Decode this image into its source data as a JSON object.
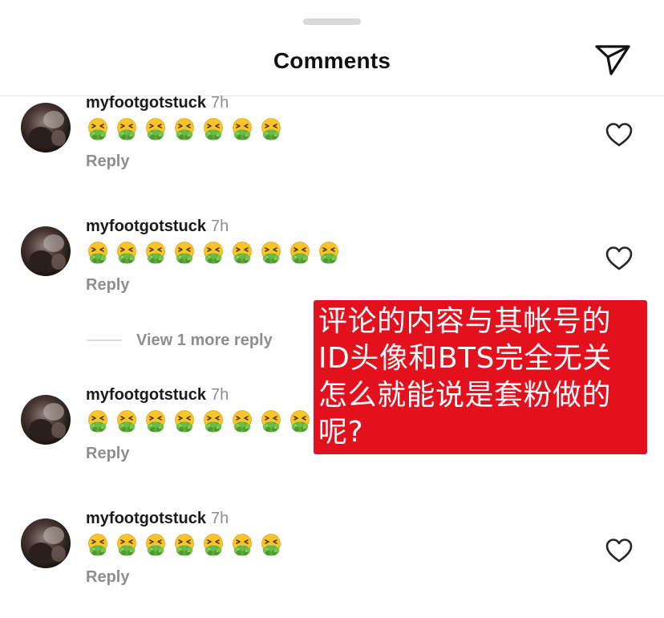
{
  "header": {
    "title": "Comments"
  },
  "comments": [
    {
      "username": "myfootgotstuck",
      "time": "7h",
      "emoji_count": 7,
      "reply_label": "Reply"
    },
    {
      "username": "myfootgotstuck",
      "time": "7h",
      "emoji_count": 9,
      "reply_label": "Reply"
    },
    {
      "username": "myfootgotstuck",
      "time": "7h",
      "emoji_count": 8,
      "reply_label": "Reply"
    },
    {
      "username": "myfootgotstuck",
      "time": "7h",
      "emoji_count": 7,
      "reply_label": "Reply"
    }
  ],
  "emoji_name": "nauseated-face-emoji",
  "view_more_label": "View 1 more reply",
  "overlay": {
    "lines": [
      "评论的内容与其帐号的",
      "ID头像和BTS完全无关",
      "怎么就能说是套粉做的",
      "呢?"
    ],
    "background_color": "#e3101d",
    "text_color": "#ffffff"
  },
  "icons": {
    "share": "paper-plane-icon",
    "like": "heart-outline-icon"
  }
}
